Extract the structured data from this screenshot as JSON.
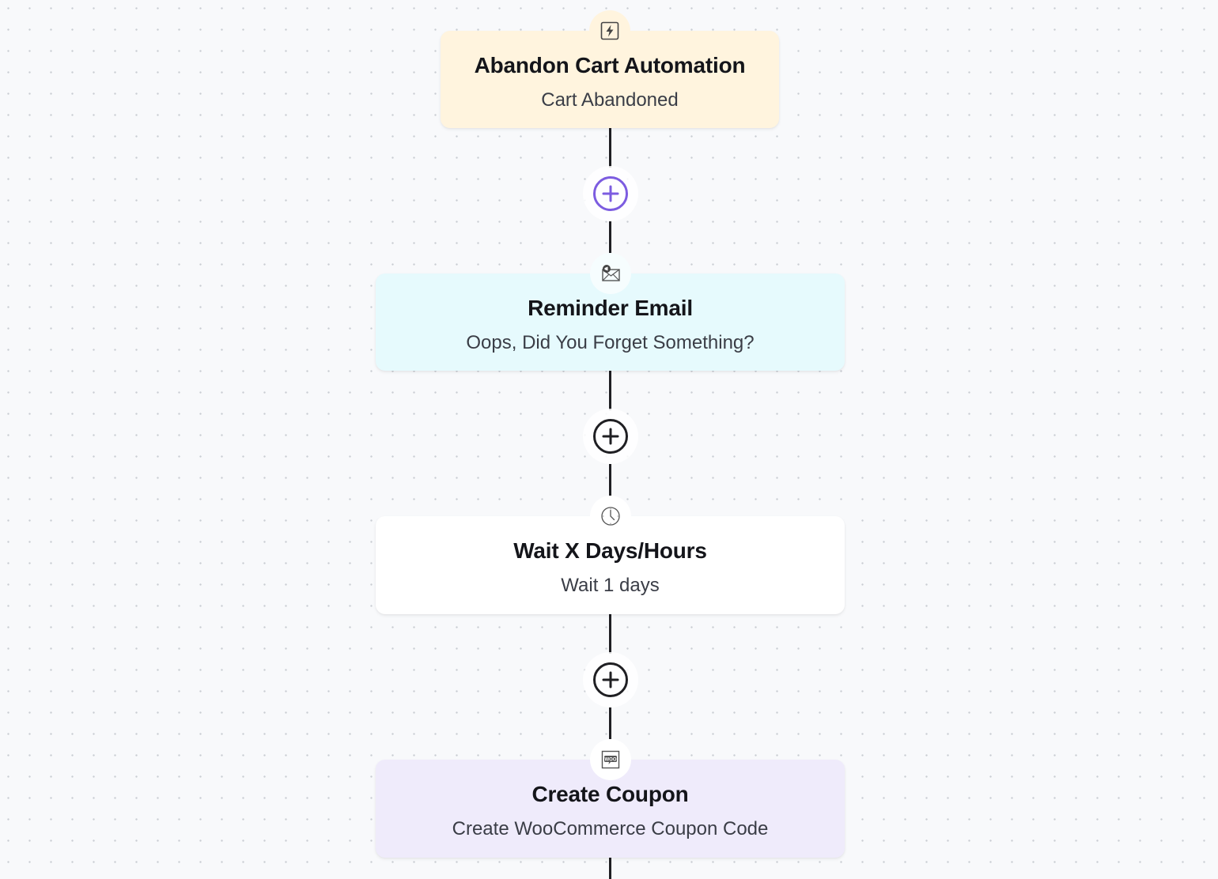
{
  "workflow": {
    "nodes": [
      {
        "type": "trigger",
        "icon": "lightning-bolt-icon",
        "title": "Abandon Cart Automation",
        "subtitle": "Cart Abandoned",
        "bg_color": "#fff4de"
      },
      {
        "type": "email",
        "icon": "email-megaphone-icon",
        "title": "Reminder Email",
        "subtitle": "Oops, Did You Forget Something?",
        "bg_color": "#e6fafd"
      },
      {
        "type": "wait",
        "icon": "clock-icon",
        "title": "Wait X Days/Hours",
        "subtitle": "Wait 1 days",
        "bg_color": "#ffffff"
      },
      {
        "type": "woocommerce",
        "icon": "woocommerce-icon",
        "title": "Create Coupon",
        "subtitle": "Create WooCommerce Coupon Code",
        "bg_color": "#efebfb"
      }
    ],
    "add_step_buttons": [
      {
        "icon": "plus-circle-icon",
        "active": true,
        "color": "#7c5ce0"
      },
      {
        "icon": "plus-circle-icon",
        "active": false,
        "color": "#1f1f23"
      },
      {
        "icon": "plus-circle-icon",
        "active": false,
        "color": "#1f1f23"
      }
    ],
    "woo_icon_text": "WOO"
  }
}
